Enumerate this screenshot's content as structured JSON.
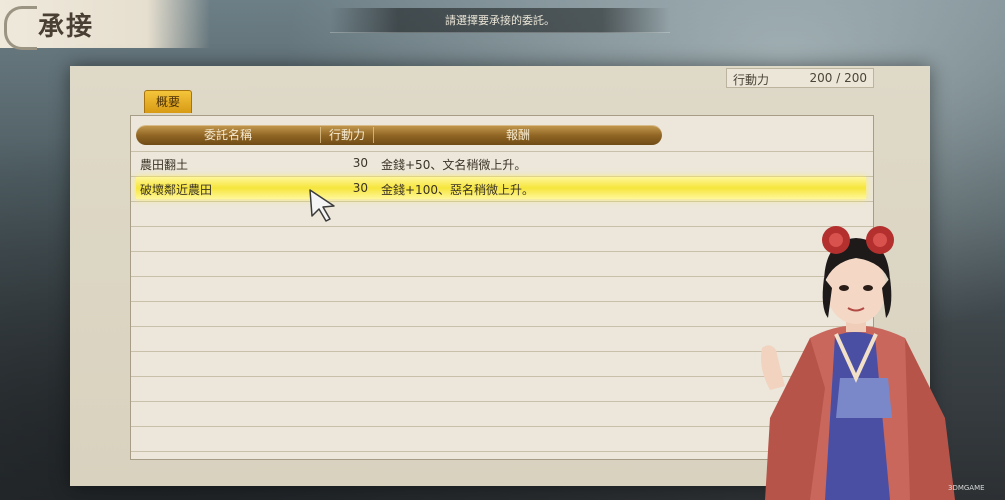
{
  "header": {
    "title": "承接",
    "instruction": "請選擇要承接的委託。"
  },
  "action_points": {
    "label": "行動力",
    "value": "200 /  200"
  },
  "tab": {
    "label": "概要"
  },
  "table": {
    "columns": [
      "委託名稱",
      "行動力",
      "報酬"
    ],
    "rows": [
      {
        "name": "農田翻土",
        "ap": "30",
        "reward": "金錢+50、文名稍微上升。"
      },
      {
        "name": "破壞鄰近農田",
        "ap": "30",
        "reward": "金錢+100、惡名稍微上升。"
      }
    ],
    "selected_index": 1
  },
  "watermark": "3DMGAME",
  "colors": {
    "highlight": "#f6e53c",
    "header_bar": "#8e6423",
    "tab": "#e0a620",
    "paper": "#ece7da"
  },
  "icons": {
    "cursor": "arrow-cursor-icon",
    "title_ornament": "scroll-ornament-icon"
  }
}
